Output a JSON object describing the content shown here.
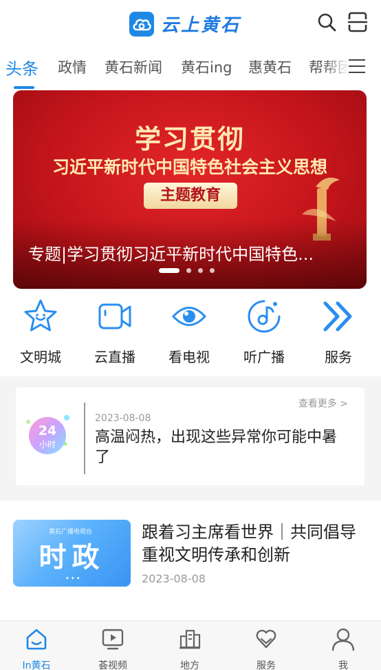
{
  "header": {
    "app_name": "云上黄石",
    "search_icon": "search-icon",
    "scan_icon": "scan-icon"
  },
  "tabs": [
    {
      "label": "头条",
      "active": true
    },
    {
      "label": "政情"
    },
    {
      "label": "黄石新闻"
    },
    {
      "label": "黄石ing"
    },
    {
      "label": "惠黄石"
    },
    {
      "label": "帮帮团"
    }
  ],
  "banner": {
    "headline": "学习贯彻",
    "subheadline": "习近平新时代中国特色社会主义思想",
    "tag": "主题教育",
    "caption": "专题|学习贯彻习近平新时代中国特色...",
    "slide_count": 4,
    "active_slide": 1
  },
  "quick_nav": [
    {
      "label": "文明城",
      "icon": "star-icon"
    },
    {
      "label": "云直播",
      "icon": "video-camera-icon"
    },
    {
      "label": "看电视",
      "icon": "eye-icon"
    },
    {
      "label": "听广播",
      "icon": "music-note-icon"
    },
    {
      "label": "服务",
      "icon": "double-chevron-right-icon"
    }
  ],
  "hot24": {
    "badge_number": "24",
    "badge_unit": "小时",
    "more_label": "查看更多 >",
    "date": "2023-08-08",
    "title": "高温闷热，出现这些异常你可能中暑了"
  },
  "news": [
    {
      "thumb_text": "时政",
      "thumb_brand": "黄石广播电视台",
      "title": "跟着习主席看世界｜共同倡导重视文明传承和创新",
      "date": "2023-08-08"
    }
  ],
  "bottom_nav": [
    {
      "label": "In黄石",
      "icon": "home-icon",
      "active": true
    },
    {
      "label": "荟视频",
      "icon": "play-screen-icon"
    },
    {
      "label": "地方",
      "icon": "buildings-icon"
    },
    {
      "label": "服务",
      "icon": "heart-hands-icon"
    },
    {
      "label": "我",
      "icon": "user-icon"
    }
  ],
  "colors": {
    "accent": "#1e88e5",
    "banner_red": "#c4151b",
    "muted_text": "#999999"
  }
}
